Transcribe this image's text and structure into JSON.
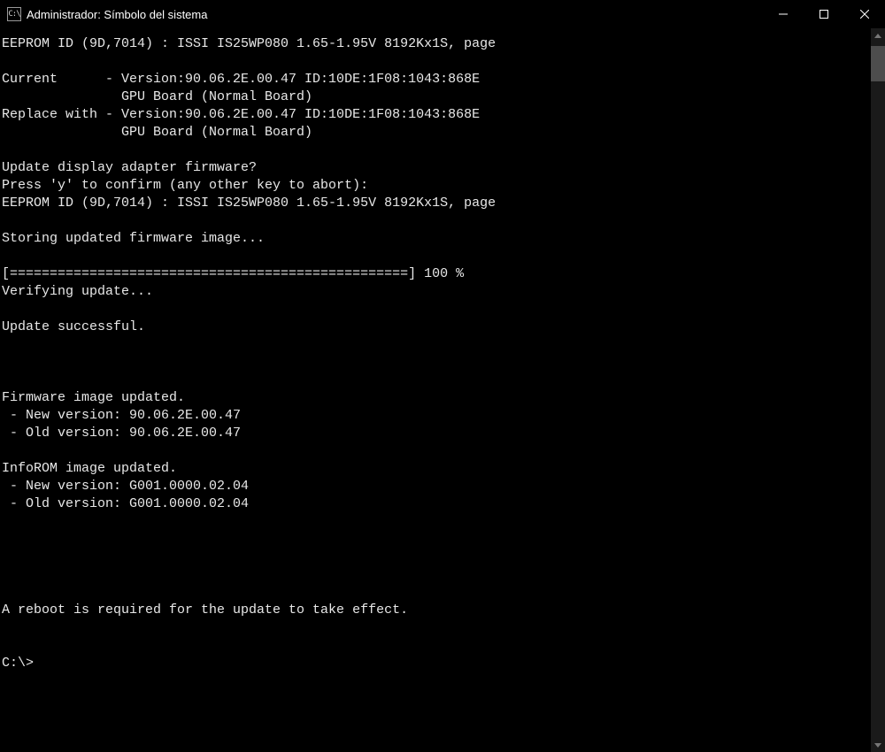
{
  "titlebar": {
    "title": "Administrador: Símbolo del sistema"
  },
  "console": {
    "lines": [
      "EEPROM ID (9D,7014) : ISSI IS25WP080 1.65-1.95V 8192Kx1S, page",
      "",
      "Current      - Version:90.06.2E.00.47 ID:10DE:1F08:1043:868E",
      "               GPU Board (Normal Board)",
      "Replace with - Version:90.06.2E.00.47 ID:10DE:1F08:1043:868E",
      "               GPU Board (Normal Board)",
      "",
      "Update display adapter firmware?",
      "Press 'y' to confirm (any other key to abort):",
      "EEPROM ID (9D,7014) : ISSI IS25WP080 1.65-1.95V 8192Kx1S, page",
      "",
      "Storing updated firmware image...",
      "",
      "[==================================================] 100 %",
      "Verifying update...",
      "",
      "Update successful.",
      "",
      "",
      "",
      "Firmware image updated.",
      " - New version: 90.06.2E.00.47",
      " - Old version: 90.06.2E.00.47",
      "",
      "InfoROM image updated.",
      " - New version: G001.0000.02.04",
      " - Old version: G001.0000.02.04",
      "",
      "",
      "",
      "",
      "",
      "A reboot is required for the update to take effect.",
      "",
      "",
      "C:\\>"
    ]
  }
}
